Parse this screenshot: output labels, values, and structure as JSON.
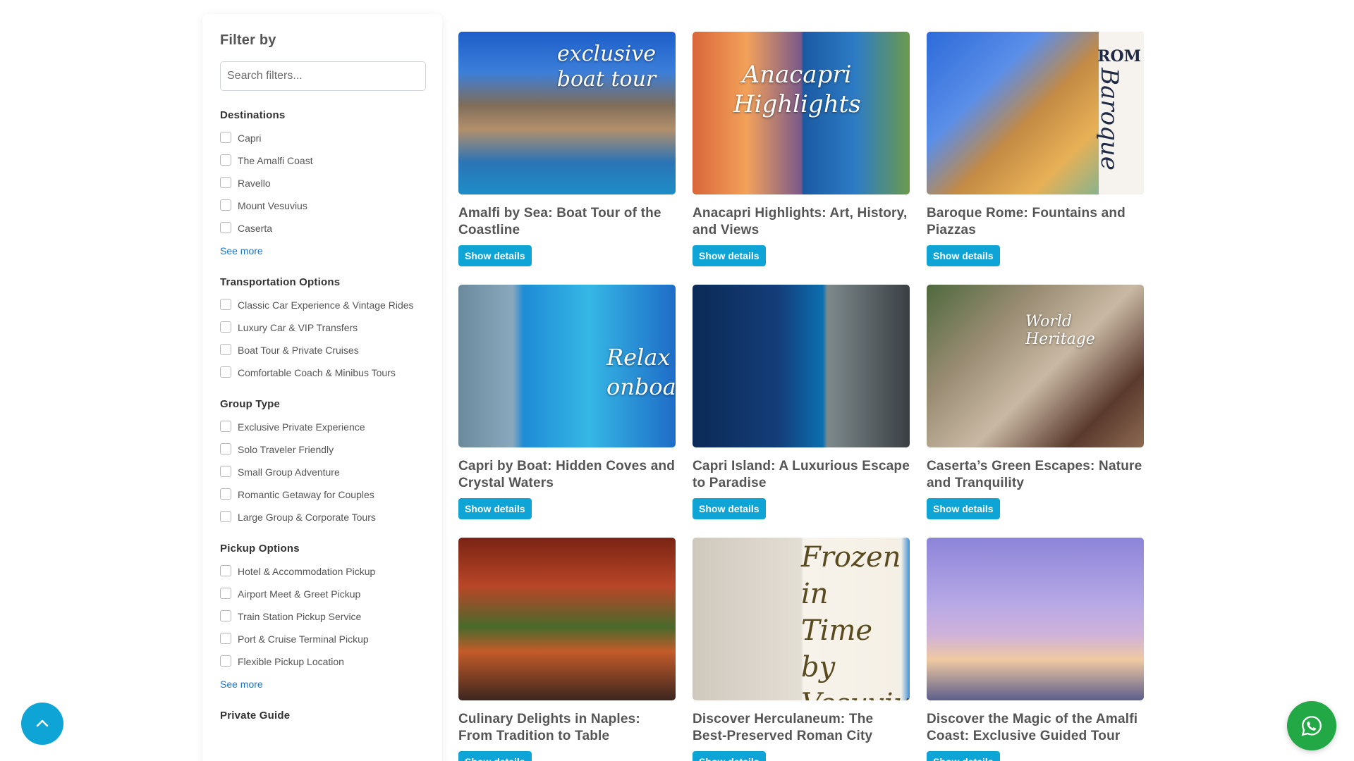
{
  "sidebar": {
    "title": "Filter by",
    "search_placeholder": "Search filters...",
    "sections": [
      {
        "title": "Destinations",
        "options": [
          "Capri",
          "The Amalfi Coast",
          "Ravello",
          "Mount Vesuvius",
          "Caserta"
        ],
        "see_more": "See more"
      },
      {
        "title": "Transportation Options",
        "options": [
          "Classic Car Experience & Vintage Rides",
          "Luxury Car & VIP Transfers",
          "Boat Tour & Private Cruises",
          "Comfortable Coach & Minibus Tours"
        ]
      },
      {
        "title": "Group Type",
        "options": [
          "Exclusive Private Experience",
          "Solo Traveler Friendly",
          "Small Group Adventure",
          "Romantic Getaway for Couples",
          "Large Group & Corporate Tours"
        ]
      },
      {
        "title": "Pickup Options",
        "options": [
          "Hotel & Accommodation Pickup",
          "Airport Meet & Greet Pickup",
          "Train Station Pickup Service",
          "Port & Cruise Terminal Pickup",
          "Flexible Pickup Location"
        ],
        "see_more": "See more"
      },
      {
        "title": "Private Guide"
      }
    ]
  },
  "tours": [
    {
      "title": "Amalfi by Sea: Boat Tour of the Coastline",
      "button": "Show details",
      "image_text": "exclusive boat tour"
    },
    {
      "title": "Anacapri Highlights: Art, History, and Views",
      "button": "Show details",
      "image_text": "Anacapri Highlights"
    },
    {
      "title": "Baroque Rome: Fountains and Piazzas",
      "button": "Show details",
      "image_text": "Baroque",
      "image_text_2": "ROM"
    },
    {
      "title": "Capri by Boat: Hidden Coves and Crystal Waters",
      "button": "Show details",
      "image_text": "Relax onboard"
    },
    {
      "title": "Capri Island: A Luxurious Escape to Paradise",
      "button": "Show details",
      "image_text": ""
    },
    {
      "title": "Caserta’s Green Escapes: Nature and Tranquility",
      "button": "Show details",
      "image_text": "World Heritage"
    },
    {
      "title": "Culinary Delights in Naples: From Tradition to Table",
      "button": "Show details",
      "image_text": ""
    },
    {
      "title": "Discover Herculaneum: The Best-Preserved Roman City",
      "button": "Show details",
      "image_text": "Frozen in Time by Vesuvius"
    },
    {
      "title": "Discover the Magic of the Amalfi Coast: Exclusive Guided Tour",
      "button": "Show details",
      "image_text": ""
    }
  ],
  "floating": {
    "scroll_top_icon": "chevron-up-icon",
    "chat_icon": "whatsapp-icon"
  },
  "colors": {
    "accent": "#0ea5d6",
    "whatsapp": "#22a845",
    "link": "#1a73c8"
  }
}
